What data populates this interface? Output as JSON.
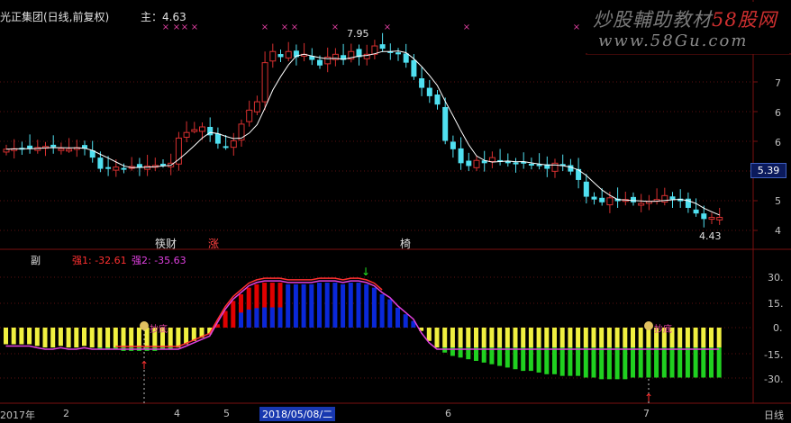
{
  "header": {
    "title": "光正集团(日线,前复权)",
    "main_indicator": "主：4.63"
  },
  "watermark": {
    "title_part1": "炒股輔助教材",
    "title_part2": "58股网",
    "url": "www.58Gu.com"
  },
  "price_axis": {
    "ticks": [
      "7",
      "6",
      "6",
      "5",
      "4",
      "4"
    ],
    "current_price": "5.39",
    "high_label": "7.95",
    "low_label": "4.43"
  },
  "signals": {
    "caifu": "筷财",
    "zhang": "涨",
    "buy_mark": "椅"
  },
  "sub_panel": {
    "label": "副",
    "value1_label": "强1: -32.61",
    "value2_label": "强2: -35.63",
    "ticks": [
      "30.",
      "15.",
      "0.",
      "-15.",
      "-30."
    ],
    "marker_text": "抄底"
  },
  "date_axis": {
    "labels": [
      "2017年",
      "2",
      "4",
      "5",
      "6",
      "7"
    ],
    "cursor_date": "2018/05/08/二",
    "period": "日线"
  },
  "colors": {
    "up": "#d83030",
    "down": "#50e0f0",
    "ma_line": "#ffffff",
    "bar_red": "#e00000",
    "bar_blue": "#0a28d8",
    "bar_yellow": "#f0f040",
    "bar_green": "#20d020",
    "line_pink": "#e040e0",
    "marker": "#e040a0"
  },
  "chart_data": {
    "type": "candlestick",
    "price_close": [
      5.85,
      5.86,
      5.87,
      5.86,
      5.88,
      5.9,
      5.89,
      5.86,
      5.85,
      5.88,
      5.86,
      5.7,
      5.5,
      5.52,
      5.53,
      5.51,
      5.54,
      5.52,
      5.55,
      5.56,
      5.58,
      5.6,
      6.05,
      6.15,
      6.2,
      6.25,
      6.1,
      5.95,
      5.9,
      6.0,
      6.3,
      6.55,
      6.7,
      7.4,
      7.6,
      7.5,
      7.6,
      7.5,
      7.55,
      7.45,
      7.35,
      7.5,
      7.55,
      7.45,
      7.6,
      7.5,
      7.55,
      7.7,
      7.65,
      7.6,
      7.55,
      7.4,
      7.15,
      6.95,
      6.8,
      6.65,
      6.0,
      5.85,
      5.6,
      5.55,
      5.65,
      5.6,
      5.7,
      5.65,
      5.6,
      5.58,
      5.62,
      5.58,
      5.55,
      5.5,
      5.6,
      5.55,
      5.45,
      5.3,
      5.0,
      4.95,
      4.9,
      4.98,
      4.92,
      4.95,
      4.9,
      4.88,
      4.92,
      4.95,
      5.02,
      4.95,
      4.92,
      4.8,
      4.7,
      4.6,
      4.63,
      4.63
    ],
    "sub_values": [
      -10,
      -10,
      -10,
      -10,
      -11,
      -12,
      -12,
      -11,
      -12,
      -12,
      -11,
      -12,
      -13,
      -13,
      -13,
      -14,
      -14,
      -14,
      -14,
      -14,
      -13,
      -13,
      -12,
      -10,
      -8,
      -6,
      -4,
      2,
      10,
      16,
      20,
      24,
      26,
      27,
      27,
      27,
      26,
      26,
      26,
      26,
      27,
      27,
      27,
      26,
      27,
      27,
      26,
      24,
      20,
      17,
      12,
      8,
      4,
      -2,
      -8,
      -12,
      -15,
      -17,
      -18,
      -19,
      -20,
      -21,
      -22,
      -23,
      -24,
      -25,
      -26,
      -26,
      -27,
      -28,
      -28,
      -29,
      -29,
      -29,
      -30,
      -30,
      -31,
      -31,
      -31,
      -31,
      -30,
      -30,
      -30,
      -30,
      -30,
      -30,
      -30,
      -30,
      -30,
      -30,
      -30,
      -30
    ],
    "sub_ticks": [
      30,
      15,
      0,
      -15,
      -30
    ],
    "xlabel": "",
    "ylabel": ""
  }
}
